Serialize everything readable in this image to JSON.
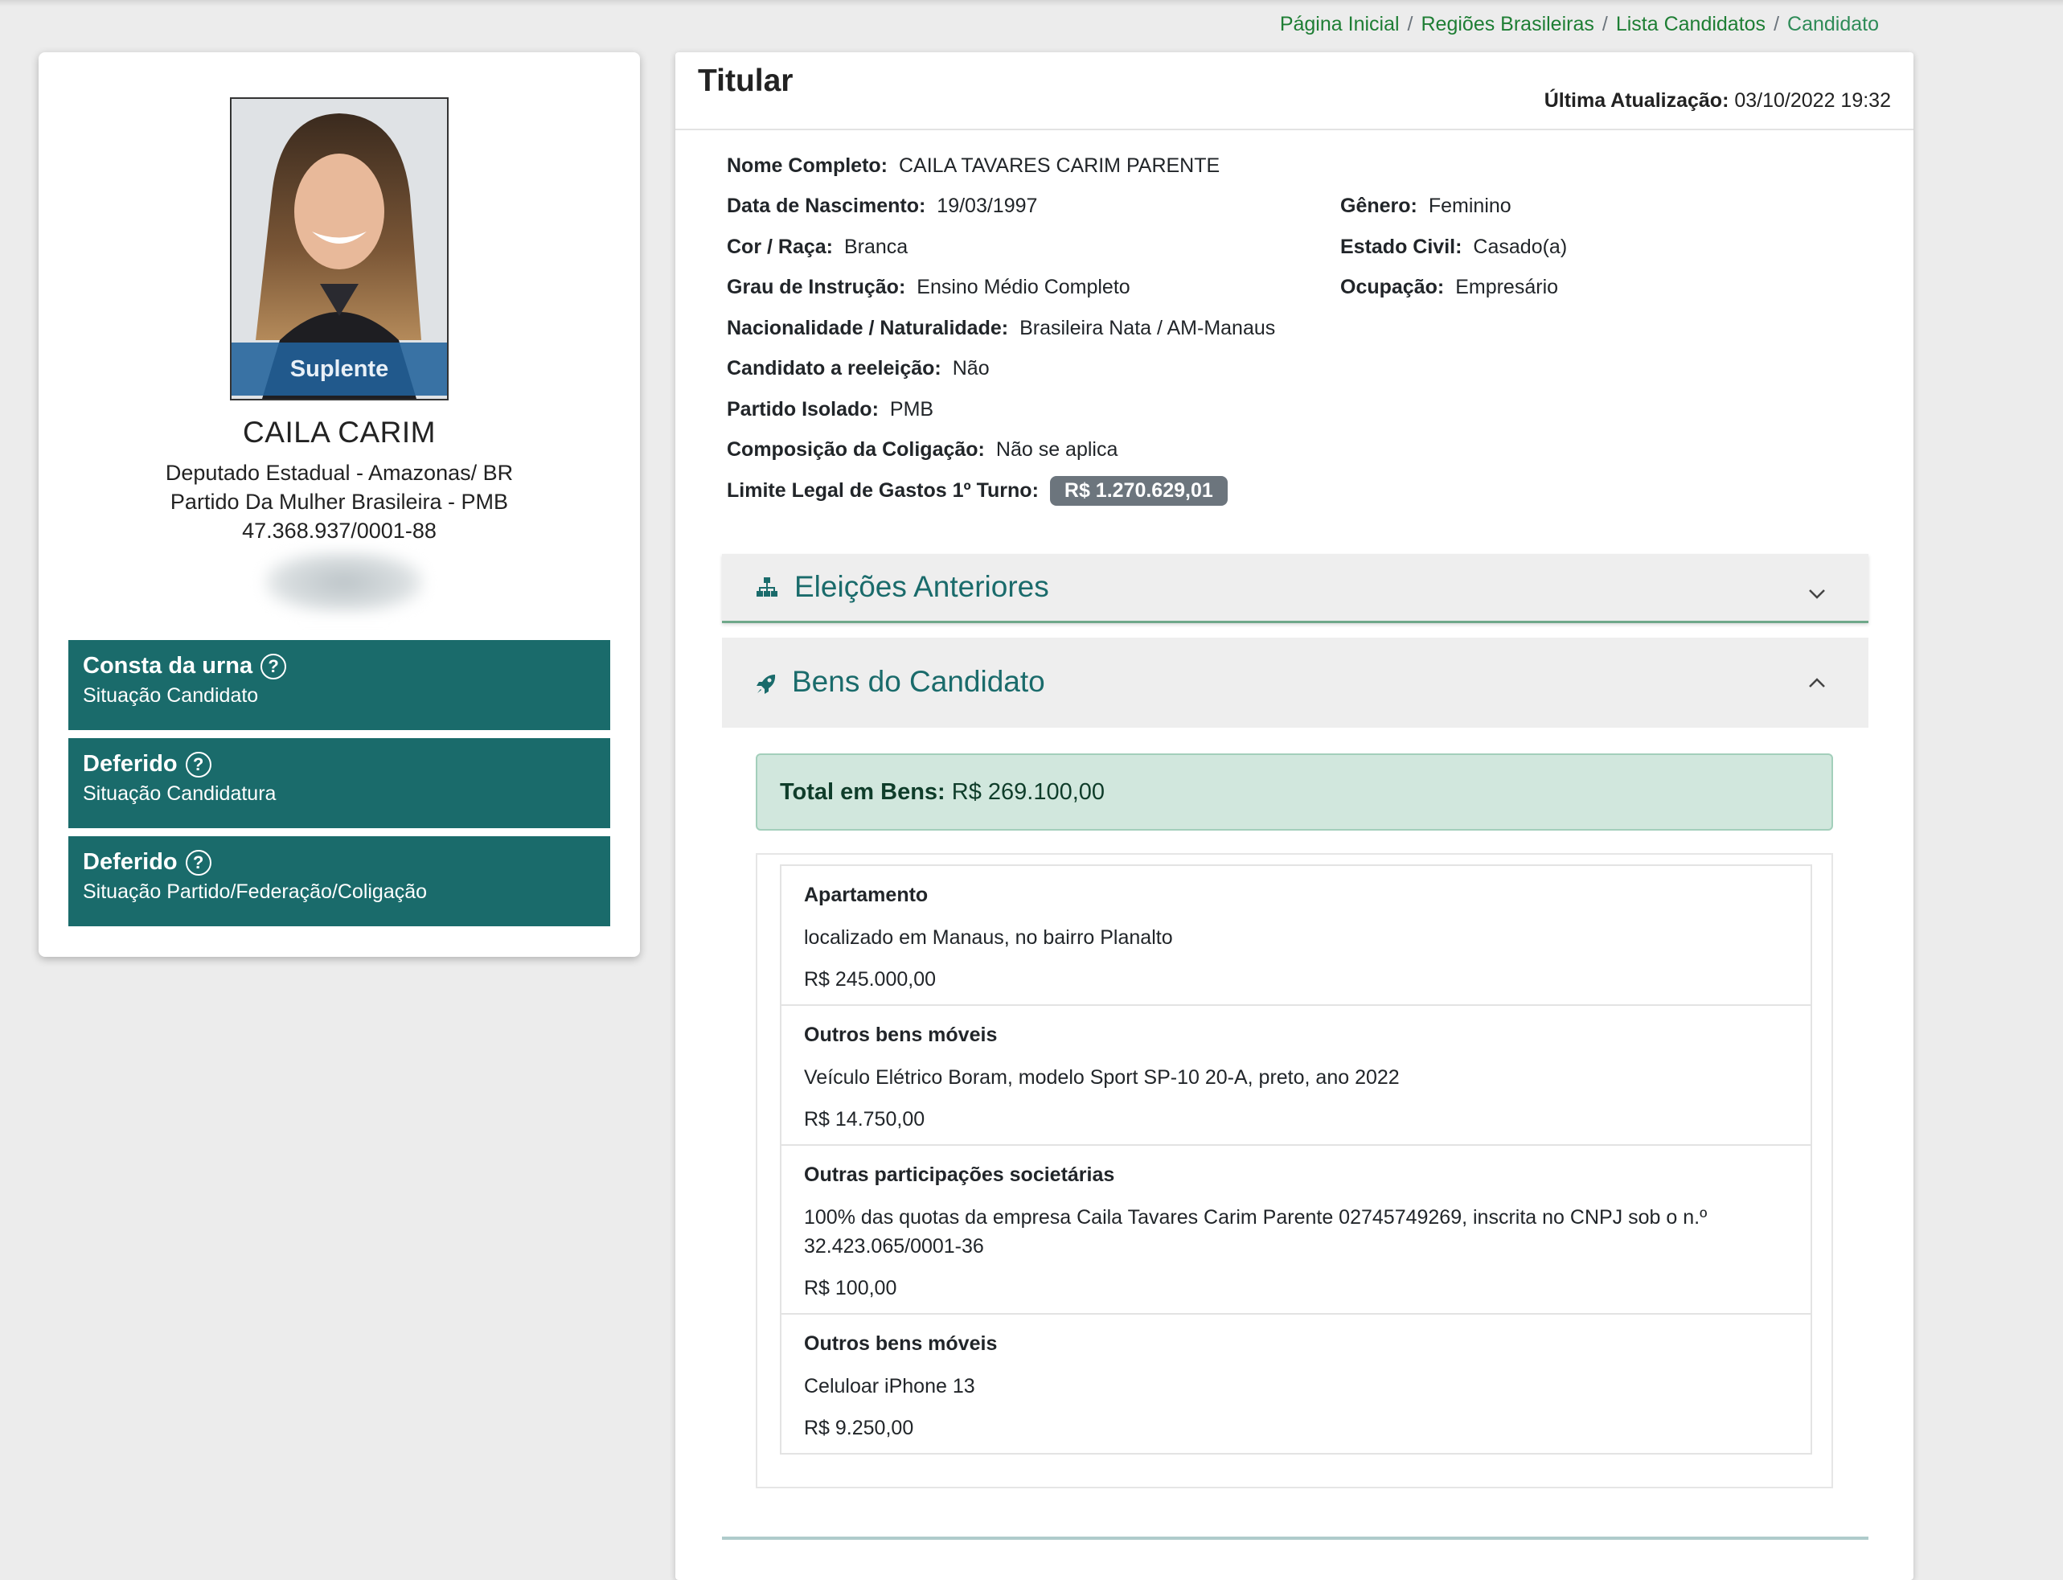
{
  "breadcrumb": {
    "items": [
      "Página Inicial",
      "Regiões Brasileiras",
      "Lista Candidatos"
    ],
    "current": "Candidato",
    "separator": "/"
  },
  "candidate": {
    "photo_badge": "Suplente",
    "name": "CAILA CARIM",
    "office": "Deputado Estadual - Amazonas/ BR",
    "party": "Partido Da Mulher Brasileira - PMB",
    "cnpj": "47.368.937/0001-88",
    "status": [
      {
        "title": "Consta da urna",
        "subtitle": "Situação Candidato"
      },
      {
        "title": "Deferido",
        "subtitle": "Situação Candidatura"
      },
      {
        "title": "Deferido",
        "subtitle": "Situação Partido/Federação/Coligação"
      }
    ],
    "help_glyph": "?"
  },
  "details": {
    "title": "Titular",
    "last_update_label": "Última Atualização:",
    "last_update_value": "03/10/2022 19:32",
    "fields": {
      "nome": {
        "label": "Nome Completo:",
        "value": "CAILA TAVARES CARIM PARENTE"
      },
      "nascimento": {
        "label": "Data de Nascimento:",
        "value": "19/03/1997"
      },
      "genero": {
        "label": "Gênero:",
        "value": "Feminino"
      },
      "cor": {
        "label": "Cor / Raça:",
        "value": "Branca"
      },
      "estado_civil": {
        "label": "Estado Civil:",
        "value": "Casado(a)"
      },
      "instrucao": {
        "label": "Grau de Instrução:",
        "value": "Ensino Médio Completo"
      },
      "ocupacao": {
        "label": "Ocupação:",
        "value": "Empresário"
      },
      "nacionalidade": {
        "label": "Nacionalidade / Naturalidade:",
        "value": "Brasileira Nata / AM-Manaus"
      },
      "reeleicao": {
        "label": "Candidato a reeleição:",
        "value": "Não"
      },
      "partido": {
        "label": "Partido Isolado:",
        "value": "PMB"
      },
      "coligacao": {
        "label": "Composição da Coligação:",
        "value": "Não se aplica"
      },
      "limite": {
        "label": "Limite Legal de Gastos 1º Turno:",
        "value": "R$ 1.270.629,01"
      }
    }
  },
  "accordions": {
    "eleicoes": {
      "title": "Eleições Anteriores",
      "icon": "sitemap-icon",
      "expanded": false
    },
    "bens": {
      "title": "Bens do Candidato",
      "icon": "rocket-icon",
      "expanded": true
    }
  },
  "bens": {
    "total_label": "Total em Bens:",
    "total_value": "R$ 269.100,00",
    "items": [
      {
        "type": "Apartamento",
        "description": "localizado em Manaus, no bairro Planalto",
        "value": "R$ 245.000,00"
      },
      {
        "type": "Outros bens móveis",
        "description": "Veículo Elétrico Boram, modelo Sport SP-10 20-A, preto, ano 2022",
        "value": "R$ 14.750,00"
      },
      {
        "type": "Outras participações societárias",
        "description": "100% das quotas da empresa Caila Tavares Carim Parente 02745749269, inscrita no CNPJ sob o n.º 32.423.065/0001-36",
        "value": "R$ 100,00"
      },
      {
        "type": "Outros bens móveis",
        "description": "Celuloar iPhone 13",
        "value": "R$ 9.250,00"
      }
    ]
  },
  "colors": {
    "accent": "#1a6b6b",
    "breadcrumb": "#1e7e34",
    "badge_money": "#6c757d",
    "alert_bg": "#d1e7dd"
  }
}
